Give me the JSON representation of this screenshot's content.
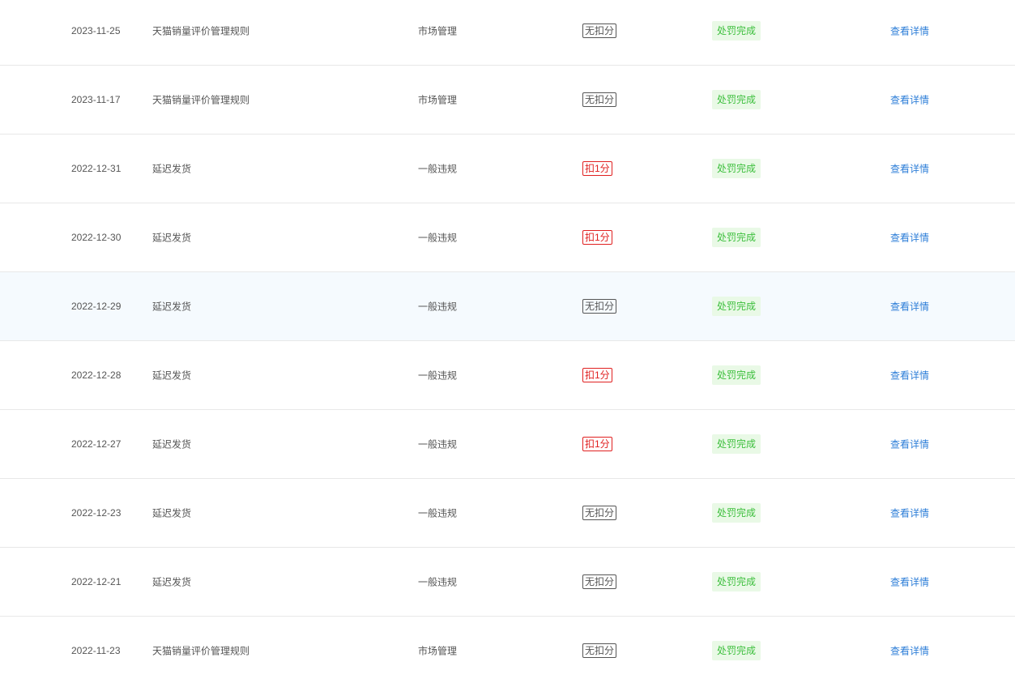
{
  "colors": {
    "status_bg": "#e9f9e6",
    "status_text": "#3cbf3c",
    "deduct": "#e02020",
    "link": "#2f7fd8",
    "row_hover": "#f5fafe"
  },
  "rows": [
    {
      "date": "2023-11-25",
      "rule": "天猫销量评价管理规则",
      "type": "市场管理",
      "score": "无扣分",
      "score_kind": "none",
      "status": "处罚完成",
      "action": "查看详情"
    },
    {
      "date": "2023-11-17",
      "rule": "天猫销量评价管理规则",
      "type": "市场管理",
      "score": "无扣分",
      "score_kind": "none",
      "status": "处罚完成",
      "action": "查看详情"
    },
    {
      "date": "2022-12-31",
      "rule": "延迟发货",
      "type": "一般违规",
      "score": "扣1分",
      "score_kind": "deduct",
      "status": "处罚完成",
      "action": "查看详情"
    },
    {
      "date": "2022-12-30",
      "rule": "延迟发货",
      "type": "一般违规",
      "score": "扣1分",
      "score_kind": "deduct",
      "status": "处罚完成",
      "action": "查看详情"
    },
    {
      "date": "2022-12-29",
      "rule": "延迟发货",
      "type": "一般违规",
      "score": "无扣分",
      "score_kind": "none",
      "status": "处罚完成",
      "action": "查看详情",
      "hover": true
    },
    {
      "date": "2022-12-28",
      "rule": "延迟发货",
      "type": "一般违规",
      "score": "扣1分",
      "score_kind": "deduct",
      "status": "处罚完成",
      "action": "查看详情"
    },
    {
      "date": "2022-12-27",
      "rule": "延迟发货",
      "type": "一般违规",
      "score": "扣1分",
      "score_kind": "deduct",
      "status": "处罚完成",
      "action": "查看详情"
    },
    {
      "date": "2022-12-23",
      "rule": "延迟发货",
      "type": "一般违规",
      "score": "无扣分",
      "score_kind": "none",
      "status": "处罚完成",
      "action": "查看详情"
    },
    {
      "date": "2022-12-21",
      "rule": "延迟发货",
      "type": "一般违规",
      "score": "无扣分",
      "score_kind": "none",
      "status": "处罚完成",
      "action": "查看详情"
    },
    {
      "date": "2022-11-23",
      "rule": "天猫销量评价管理规则",
      "type": "市场管理",
      "score": "无扣分",
      "score_kind": "none",
      "status": "处罚完成",
      "action": "查看详情"
    }
  ]
}
